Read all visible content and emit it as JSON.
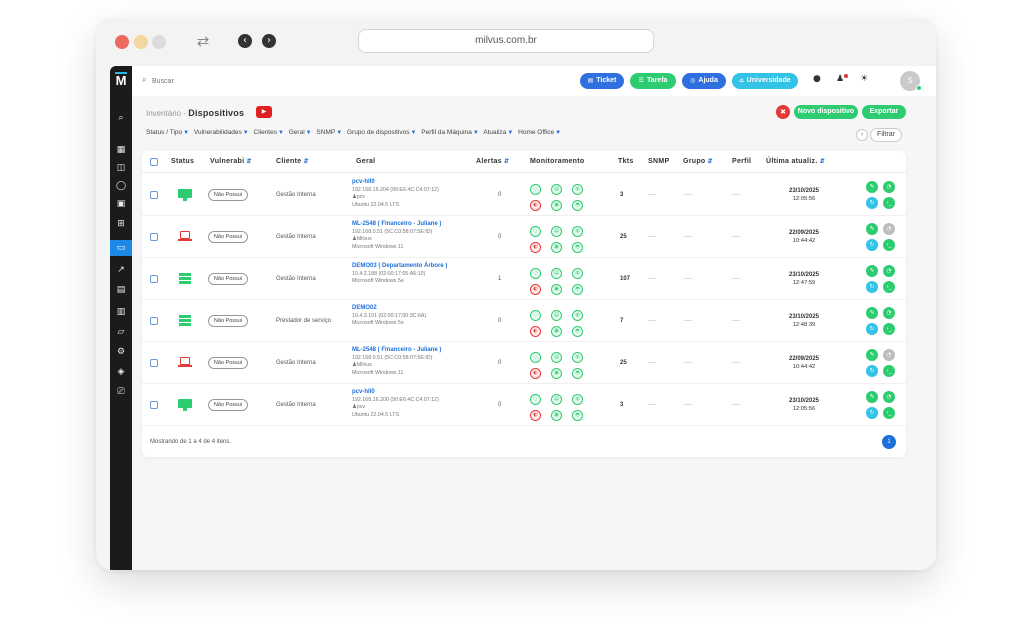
{
  "browser": {
    "url": "milvus.com.br"
  },
  "topbar": {
    "search_placeholder": "Buscar",
    "buttons": [
      {
        "label": "Ticket",
        "color": "#2f6fe0",
        "icon": "ticket-icon"
      },
      {
        "label": "Tarefa",
        "color": "#2ecc71",
        "icon": "task-icon"
      },
      {
        "label": "Ajuda",
        "color": "#2f6fe0",
        "icon": "help-icon"
      },
      {
        "label": "Universidade",
        "color": "#33c3e6",
        "icon": "university-icon"
      }
    ],
    "avatar_initial": "S"
  },
  "page": {
    "breadcrumb": "Inventário",
    "separator": " - ",
    "title": "Dispositivos",
    "new_device_label": "Novo dispositivo",
    "export_label": "Exportar",
    "filter_button": "Filtrar"
  },
  "filters": [
    "Status / Tipo",
    "Vulnerabilidades",
    "Clientes",
    "Geral",
    "SNMP",
    "Grupo de dispositivos",
    "Perfil da Máquina",
    "Atualiza",
    "Home Office"
  ],
  "table": {
    "headers": {
      "status": "Status",
      "vulnerabilities": "Vulnerabi",
      "client": "Cliente",
      "general": "Geral",
      "alerts": "Alertas",
      "monitoring": "Monitoramento",
      "tickets": "Tkts",
      "snmp": "SNMP",
      "group": "Grupo",
      "profile": "Perfil",
      "last_update": "Última atualiz."
    },
    "rows": [
      {
        "device_type": "monitor",
        "status_color": "#2ecc71",
        "vulnerability": "Não Possui",
        "client": "Gestão Interna",
        "name": "pcv-hll0",
        "ip_mac": "192.168.16.204 (90:E6:4C:C4:07:12)",
        "user": "pcv",
        "os": "Ubuntu 22.04.5 LTS",
        "alerts": "0",
        "tickets": "3",
        "snmp": "----",
        "group": "----",
        "profile": "----",
        "date": "23/10/2025",
        "time": "12:05:56",
        "mon_alert": "red",
        "action_status": "green"
      },
      {
        "device_type": "laptop",
        "status_color": "#e53935",
        "vulnerability": "Não Possui",
        "client": "Gestão Interna",
        "name": "ML-2548 ( Financeiro - Juliane )",
        "ip_mac": "192.168.0.51 (5C:C0:58:07:5E:ID)",
        "user": "Milvus",
        "os": "Microsoft Windows 11",
        "alerts": "0",
        "tickets": "25",
        "snmp": "----",
        "group": "----",
        "profile": "----",
        "date": "22/09/2025",
        "time": "10:44:42",
        "mon_alert": "red",
        "action_status": "gray"
      },
      {
        "device_type": "server",
        "status_color": "#2ecc71",
        "vulnerability": "Não Possui",
        "client": "Gestão Interna",
        "name": "DEMO03 ( Departamento Árbore )",
        "ip_mac": "10.4.2.188 (02:00:17:05:A5:10)",
        "user": "",
        "os": "Microsoft Windows 5e",
        "alerts": "1",
        "tickets": "107",
        "snmp": "----",
        "group": "----",
        "profile": "----",
        "date": "23/10/2025",
        "time": "12:47:59",
        "mon_alert": "red",
        "action_status": "green"
      },
      {
        "device_type": "server",
        "status_color": "#2ecc71",
        "vulnerability": "Não Possui",
        "client": "Prestador de serviço",
        "name": "DEMO02",
        "ip_mac": "10.4.3.101 (02:00:17:00:3C:6A)",
        "user": "",
        "os": "Microsoft Windows 5e",
        "alerts": "0",
        "tickets": "7",
        "snmp": "----",
        "group": "----",
        "profile": "----",
        "date": "23/10/2025",
        "time": "12:48:39",
        "mon_alert": "red",
        "action_status": "green"
      },
      {
        "device_type": "laptop",
        "status_color": "#e53935",
        "vulnerability": "Não Possui",
        "client": "Gestão Interna",
        "name": "ML-2548 ( Financeiro - Juliane )",
        "ip_mac": "192.168.0.51 (5C:C0:58:07:5E:ID)",
        "user": "Milvus",
        "os": "Microsoft Windows 11",
        "alerts": "0",
        "tickets": "25",
        "snmp": "----",
        "group": "----",
        "profile": "----",
        "date": "22/09/2025",
        "time": "10:44:42",
        "mon_alert": "red",
        "action_status": "gray"
      },
      {
        "device_type": "monitor",
        "status_color": "#2ecc71",
        "vulnerability": "Não Possui",
        "client": "Gestão Interna",
        "name": "pcv-hll0",
        "ip_mac": "192.168.16.200 (90:E6:4C:C4:07:12)",
        "user": "pcv",
        "os": "Ubuntu 22.04.5 LTS",
        "alerts": "0",
        "tickets": "3",
        "snmp": "----",
        "group": "----",
        "profile": "----",
        "date": "23/10/2025",
        "time": "12:05:56",
        "mon_alert": "red",
        "action_status": "green"
      }
    ],
    "footer": "Mostrando de 1 a 4 de 4 itens.",
    "current_page": "1"
  }
}
